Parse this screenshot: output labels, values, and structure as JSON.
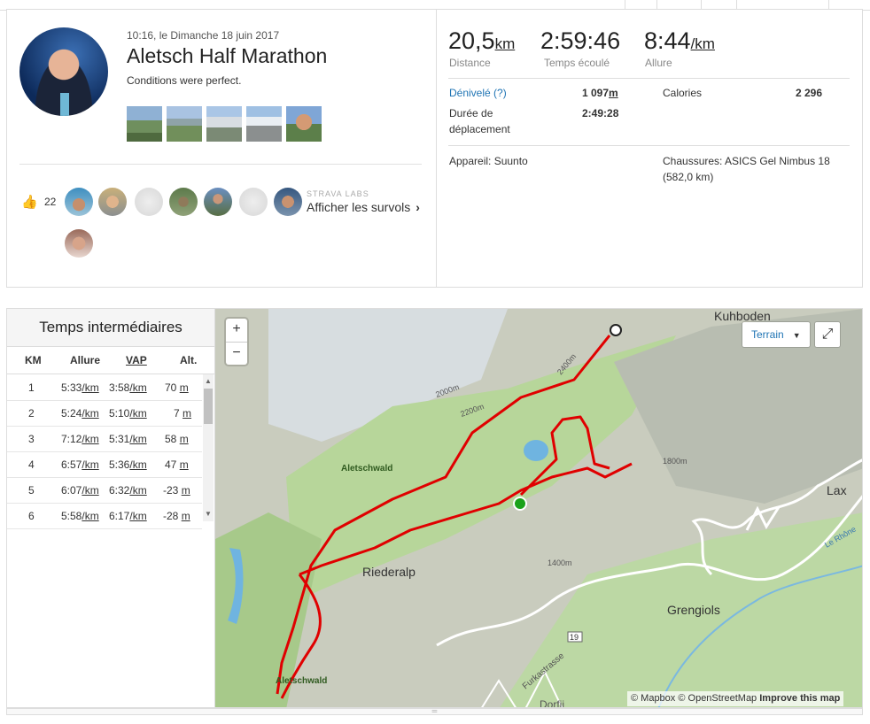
{
  "activity": {
    "datetime": "10:16, le Dimanche 18 juin 2017",
    "title": "Aletsch Half Marathon",
    "description": "Conditions were perfect."
  },
  "kudos": {
    "count": "22",
    "labs_label": "STRAVA LABS",
    "flybys_label": "Afficher les survols",
    "flybys_chevron": "›"
  },
  "stats": {
    "distance_value": "20,5",
    "distance_unit": "km",
    "distance_label": "Distance",
    "elapsed_value": "2:59:46",
    "elapsed_label": "Temps écoulé",
    "pace_value": "8:44",
    "pace_unit": "/km",
    "pace_label": "Allure",
    "elevation_label": "Dénivelé (?)",
    "elevation_value": "1 097",
    "elevation_unit": "m",
    "calories_label": "Calories",
    "calories_value": "2 296",
    "moving_label_1": "Durée de",
    "moving_label_2": "déplacement",
    "moving_value": "2:49:28",
    "device": "Appareil: Suunto",
    "shoes_1": "Chaussures: ASICS Gel Nimbus 18",
    "shoes_2": "(582,0 km)"
  },
  "splits": {
    "title": "Temps intermédiaires",
    "headers": {
      "km": "KM",
      "pace": "Allure",
      "gap": "VAP",
      "alt": "Alt."
    },
    "unit_km": "/km",
    "unit_m": "m",
    "rows": [
      {
        "km": "1",
        "pace": "5:33",
        "gap": "3:58",
        "alt": "70"
      },
      {
        "km": "2",
        "pace": "5:24",
        "gap": "5:10",
        "alt": "7"
      },
      {
        "km": "3",
        "pace": "7:12",
        "gap": "5:31",
        "alt": "58"
      },
      {
        "km": "4",
        "pace": "6:57",
        "gap": "5:36",
        "alt": "47"
      },
      {
        "km": "5",
        "pace": "6:07",
        "gap": "6:32",
        "alt": "-23"
      },
      {
        "km": "6",
        "pace": "5:58",
        "gap": "6:17",
        "alt": "-28"
      }
    ]
  },
  "map": {
    "zoom_in": "+",
    "zoom_out": "−",
    "layer_select": "Terrain",
    "fullscreen_icon": "⤢",
    "labels": {
      "kuhboden": "Kuhboden",
      "lax": "Lax",
      "riederalp": "Riederalp",
      "grengiols": "Grengiols",
      "aletschwald_top": "Aletschwald",
      "aletschwald_bottom": "Aletschwald",
      "dorfji": "Dorfji",
      "furkastrasse": "Furkastrasse",
      "le_rhone": "Le Rhône",
      "road_19": "19",
      "contour_1": "2000m",
      "contour_2": "2200m",
      "contour_3": "2400m",
      "contour_4": "1800m",
      "contour_5": "1400m"
    },
    "attribution_mapbox": "© Mapbox",
    "attribution_osm": "© OpenStreetMap",
    "attribution_improve": "Improve this map"
  },
  "colors": {
    "route": "#e00000",
    "link_blue": "#1f74b4",
    "start_marker": "#1aa21a"
  }
}
